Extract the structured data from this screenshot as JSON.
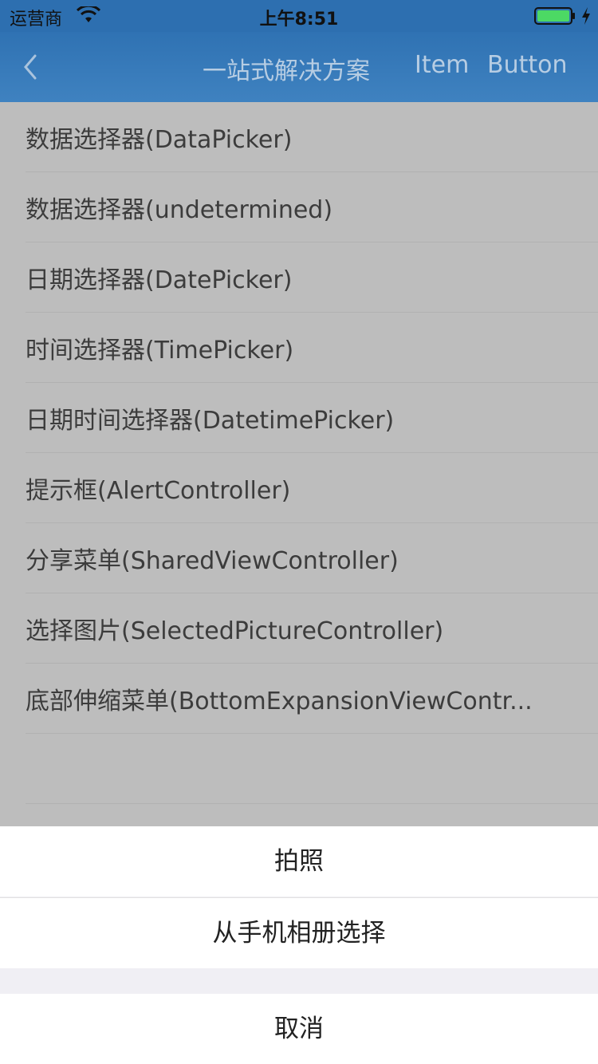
{
  "status_bar": {
    "carrier": "运营商",
    "time": "上午8:51",
    "icons": [
      "wifi-icon",
      "battery-icon",
      "charging-icon"
    ]
  },
  "nav": {
    "title": "一站式解决方案",
    "item_label": "Item",
    "button_label": "Button",
    "back_icon": "chevron-left-icon"
  },
  "list": {
    "items": [
      "数据选择器(DataPicker)",
      "数据选择器(undetermined)",
      "日期选择器(DatePicker)",
      "时间选择器(TimePicker)",
      "日期时间选择器(DatetimePicker)",
      "提示框(AlertController)",
      "分享菜单(SharedViewController)",
      "选择图片(SelectedPictureController)",
      "底部伸缩菜单(BottomExpansionViewContr..."
    ]
  },
  "action_sheet": {
    "options": [
      "拍照",
      "从手机相册选择"
    ],
    "cancel": "取消"
  },
  "colors": {
    "nav_bg": "#2f72b3",
    "dimmed_list_bg": "#bdbdbd",
    "sheet_bg": "#f0eff4"
  }
}
